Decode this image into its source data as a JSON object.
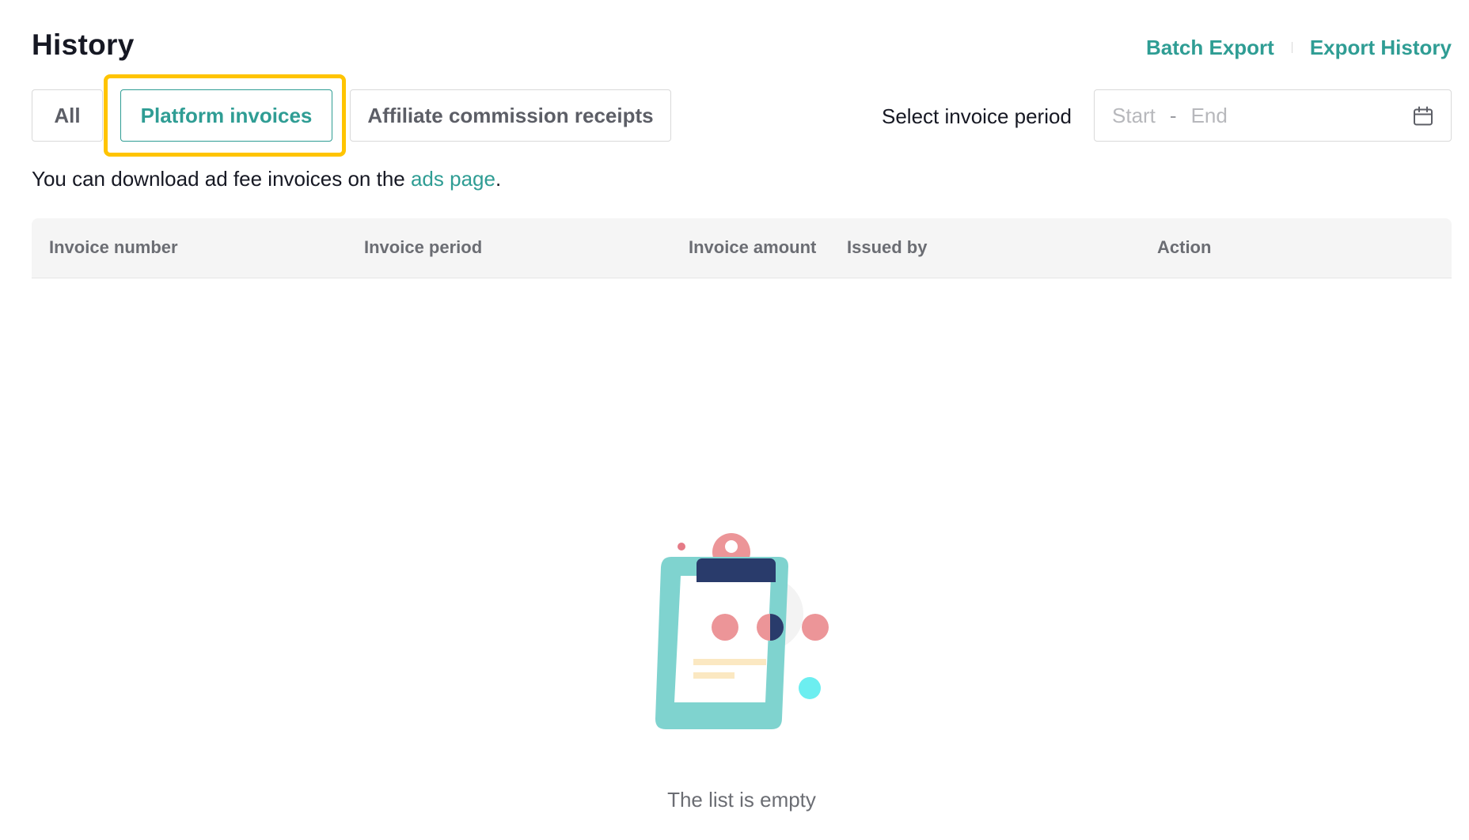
{
  "header": {
    "title": "History",
    "links": [
      "Batch Export",
      "Export History"
    ]
  },
  "tabs": [
    "All",
    "Platform invoices",
    "Affiliate commission receipts"
  ],
  "active_tab": "Platform invoices",
  "filter": {
    "label": "Select invoice period",
    "start_placeholder": "Start",
    "separator": "-",
    "end_placeholder": "End"
  },
  "info": {
    "prefix": "You can download ad fee invoices on the ",
    "link": "ads page",
    "suffix": "."
  },
  "table": {
    "columns": [
      "Invoice number",
      "Invoice period",
      "Invoice amount",
      "Issued by",
      "Action"
    ],
    "rows": []
  },
  "empty_state": {
    "icon": "clipboard-empty-icon",
    "text": "The list is empty"
  },
  "colors": {
    "accent": "#2f9d94",
    "highlight": "#ffc400"
  }
}
